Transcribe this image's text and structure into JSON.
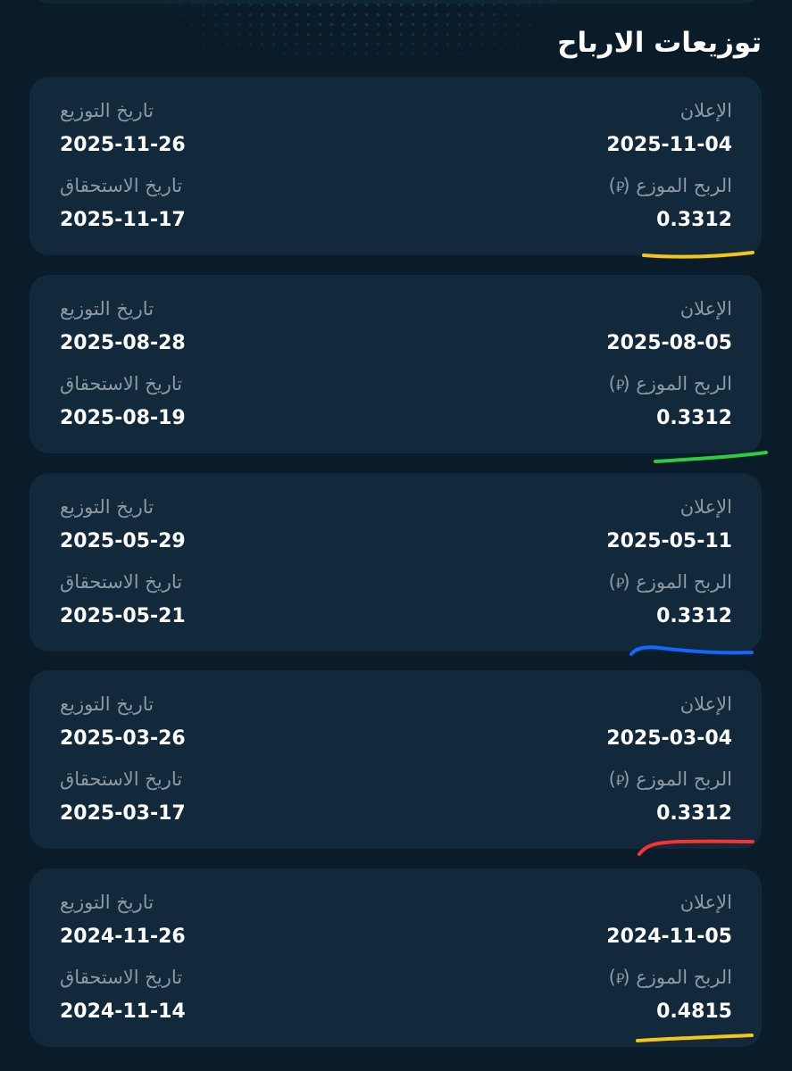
{
  "page": {
    "title": "توزيعات الارباح"
  },
  "labels": {
    "announcement": "الإعلان",
    "distributed_profit": "الربح الموزع",
    "distribution_date": "تاريخ التوزيع",
    "due_date": "تاريخ الاستحقاق"
  },
  "icons": {
    "currency": "saudi-riyal-icon"
  },
  "colors": {
    "background": "#0a1c29",
    "card": "#11293a",
    "label": "#8c9aa4",
    "value": "#ffffff"
  },
  "dividends": [
    {
      "announcement": "2025-11-04",
      "profit": "0.3312",
      "distribution_date": "2025-11-26",
      "due_date": "2025-11-17"
    },
    {
      "announcement": "2025-08-05",
      "profit": "0.3312",
      "distribution_date": "2025-08-28",
      "due_date": "2025-08-19"
    },
    {
      "announcement": "2025-05-11",
      "profit": "0.3312",
      "distribution_date": "2025-05-29",
      "due_date": "2025-05-21"
    },
    {
      "announcement": "2025-03-04",
      "profit": "0.3312",
      "distribution_date": "2025-03-26",
      "due_date": "2025-03-17"
    },
    {
      "announcement": "2024-11-05",
      "profit": "0.4815",
      "distribution_date": "2024-11-26",
      "due_date": "2024-11-14"
    }
  ],
  "annotations": [
    {
      "color": "#f5c518"
    },
    {
      "color": "#2ecc40"
    },
    {
      "color": "#1565ff"
    },
    {
      "color": "#ff3030"
    },
    {
      "color": "#f5c518"
    }
  ]
}
